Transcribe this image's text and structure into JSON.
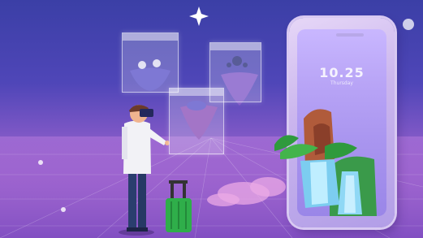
{
  "scene": {
    "phone": {
      "time": "10.25",
      "date": "Thursday"
    },
    "panels": [
      {
        "title": ""
      },
      {
        "title": ""
      },
      {
        "title": ""
      }
    ],
    "colors": {
      "sky_top": "#3b3fa6",
      "sky_bottom": "#d9a0e6",
      "suitcase": "#2fae4a",
      "waterfall": "#8fd8f5"
    }
  }
}
